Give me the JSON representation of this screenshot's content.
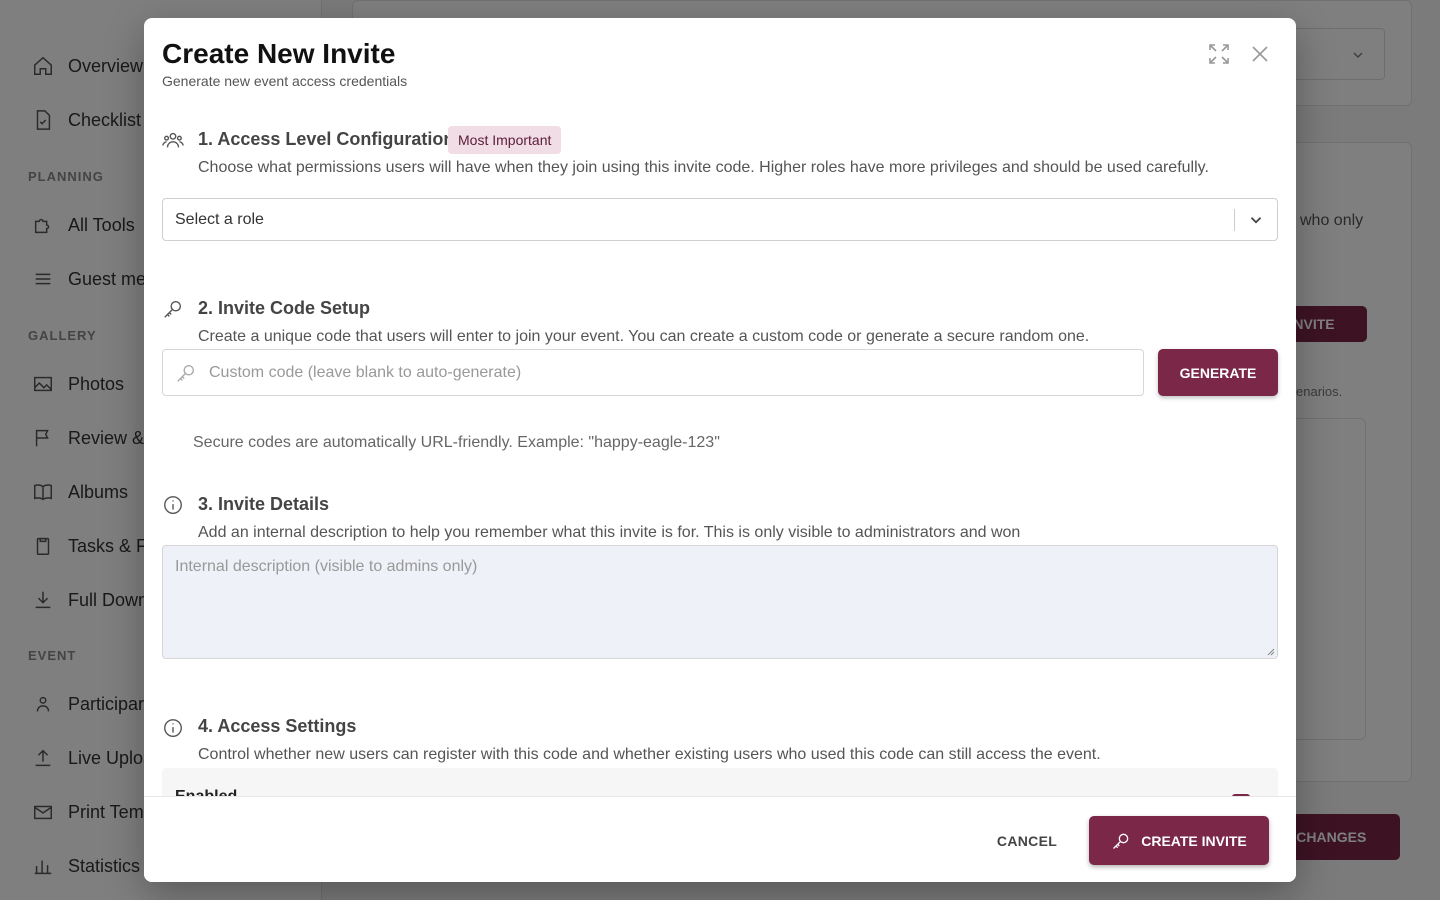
{
  "sidebar": {
    "items": [
      {
        "label": "Overview",
        "icon": "home-icon"
      },
      {
        "label": "Checklist",
        "icon": "document-check-icon"
      },
      {
        "label": "All Tools",
        "icon": "puzzle-icon"
      },
      {
        "label": "Guest me",
        "icon": "list-icon"
      },
      {
        "label": "Photos",
        "icon": "image-icon"
      },
      {
        "label": "Review &",
        "icon": "flag-icon"
      },
      {
        "label": "Albums",
        "icon": "book-icon"
      },
      {
        "label": "Tasks & F",
        "icon": "clipboard-icon"
      },
      {
        "label": "Full Down",
        "icon": "download-icon"
      },
      {
        "label": "Participar",
        "icon": "users-icon"
      },
      {
        "label": "Live Uploa",
        "icon": "upload-icon"
      },
      {
        "label": "Print Tem",
        "icon": "envelope-icon"
      },
      {
        "label": "Statistics",
        "icon": "bar-chart-icon"
      }
    ],
    "sections": {
      "planning": "PLANNING",
      "gallery": "GALLERY",
      "event": "EVENT"
    }
  },
  "background": {
    "side_text": "who only",
    "side_small": "enarios.",
    "invite_button": "W INVITE",
    "save_button": "VE CHANGES"
  },
  "modal": {
    "title": "Create New Invite",
    "subtitle": "Generate new event access credentials",
    "sections": [
      {
        "title": "1. Access Level Configuration",
        "badge": "Most Important",
        "description": "Choose what permissions users will have when they join using this invite code. Higher roles have more privileges and should be used carefully.",
        "icon": "users-icon"
      },
      {
        "title": "2. Invite Code Setup",
        "description": "Create a unique code that users will enter to join your event. You can create a custom code or generate a secure random one.",
        "icon": "key-icon"
      },
      {
        "title": "3. Invite Details",
        "description": "Add an internal description to help you remember what this invite is for. This is only visible to administrators and won",
        "icon": "info-icon"
      },
      {
        "title": "4. Access Settings",
        "description": "Control whether new users can register with this code and whether existing users who used this code can still access the event.",
        "icon": "info-icon"
      }
    ],
    "role_select": {
      "value": "Select a role"
    },
    "code_input": {
      "placeholder": "Custom code (leave blank to auto-generate)"
    },
    "generate_label": "GENERATE",
    "hint": "Secure codes are automatically URL-friendly. Example: \"happy-eagle-123\"",
    "description_input": {
      "placeholder": "Internal description (visible to admins only)"
    },
    "enabled_label": "Enabled",
    "enabled_checked": true,
    "cancel_label": "CANCEL",
    "create_label": "CREATE INVITE"
  },
  "colors": {
    "accent": "#7a2748",
    "badge_bg": "#f1dde5"
  }
}
